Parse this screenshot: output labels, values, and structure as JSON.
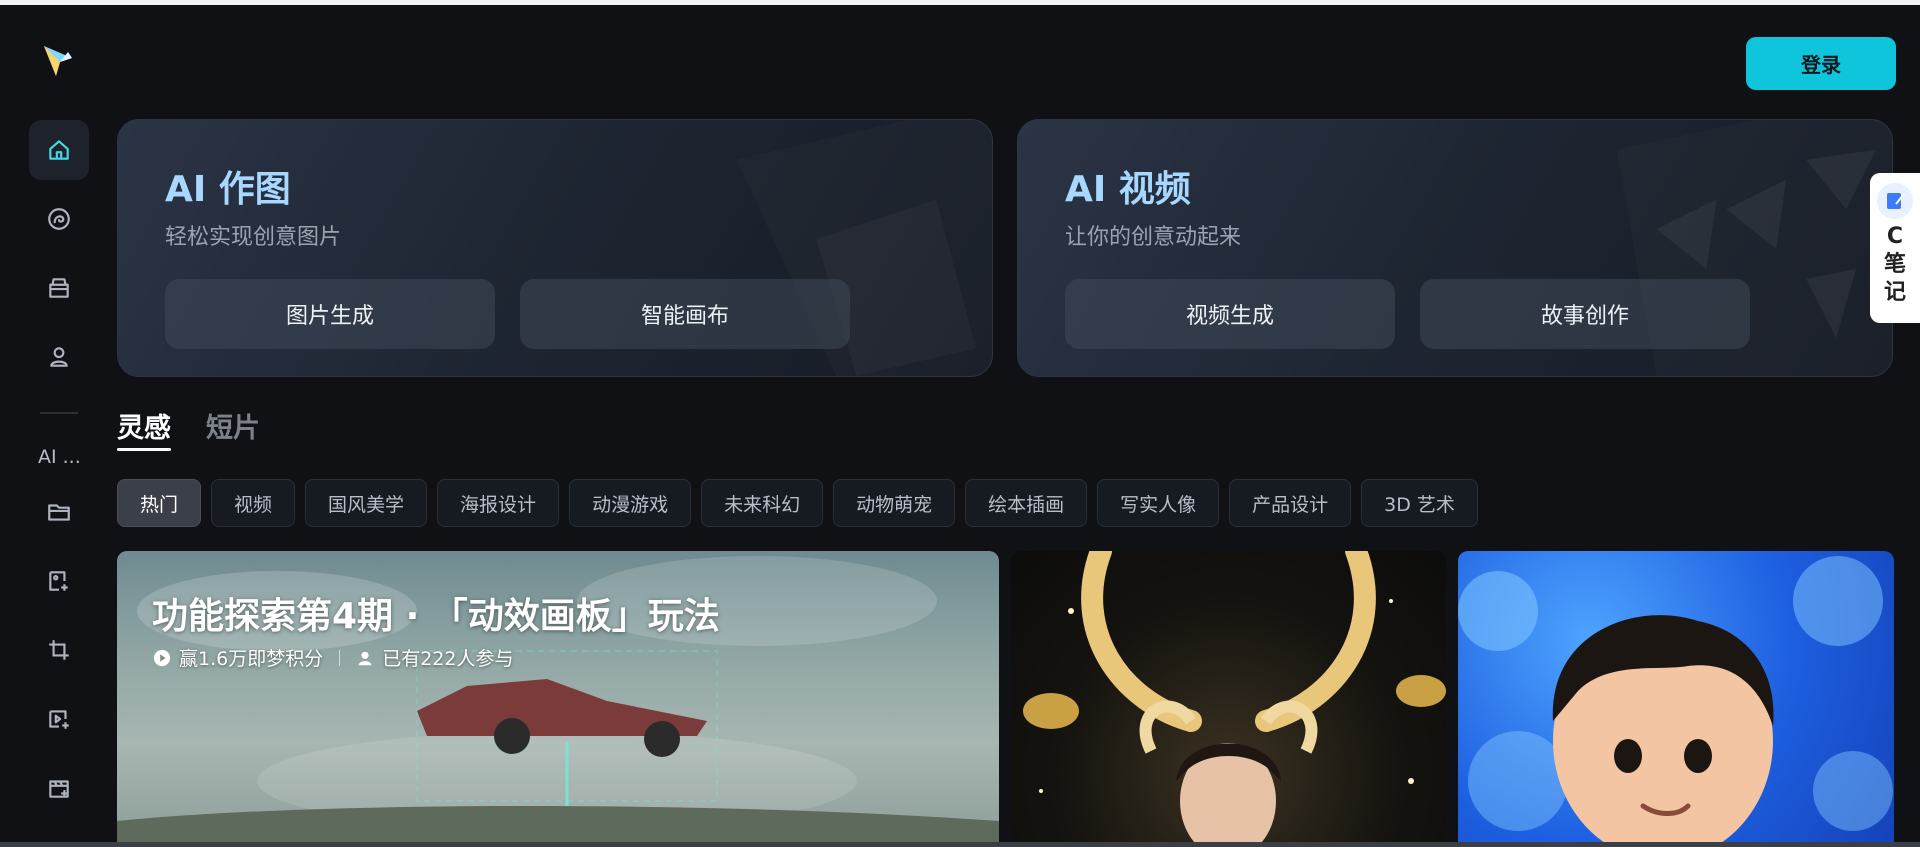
{
  "header": {
    "login_label": "登录"
  },
  "sidebar": {
    "items": [
      {
        "icon": "home-icon"
      },
      {
        "icon": "swirl-icon"
      },
      {
        "icon": "store-icon"
      },
      {
        "icon": "user-icon"
      }
    ],
    "section_label": "AI ...",
    "tools": [
      {
        "icon": "folder-icon"
      },
      {
        "icon": "image-sparkle-icon"
      },
      {
        "icon": "crop-icon"
      },
      {
        "icon": "video-sparkle-icon"
      },
      {
        "icon": "clapboard-icon"
      }
    ]
  },
  "feature_cards": [
    {
      "title": "AI 作图",
      "subtitle": "轻松实现创意图片",
      "buttons": [
        "图片生成",
        "智能画布"
      ]
    },
    {
      "title": "AI 视频",
      "subtitle": "让你的创意动起来",
      "buttons": [
        "视频生成",
        "故事创作"
      ]
    }
  ],
  "tabs": [
    "灵感",
    "短片"
  ],
  "categories": [
    "热门",
    "视频",
    "国风美学",
    "海报设计",
    "动漫游戏",
    "未来科幻",
    "动物萌宠",
    "绘本插画",
    "写实人像",
    "产品设计",
    "3D 艺术"
  ],
  "banner": {
    "title": "功能探索第4期 · 「动效画板」玩法",
    "reward": "赢1.6万即梦积分",
    "participants": "已有222人参与"
  },
  "note_widget": {
    "label": "C笔记"
  },
  "colors": {
    "accent": "#0fc5dc",
    "background": "#0f1115",
    "card_title": "#a8d8ff"
  }
}
